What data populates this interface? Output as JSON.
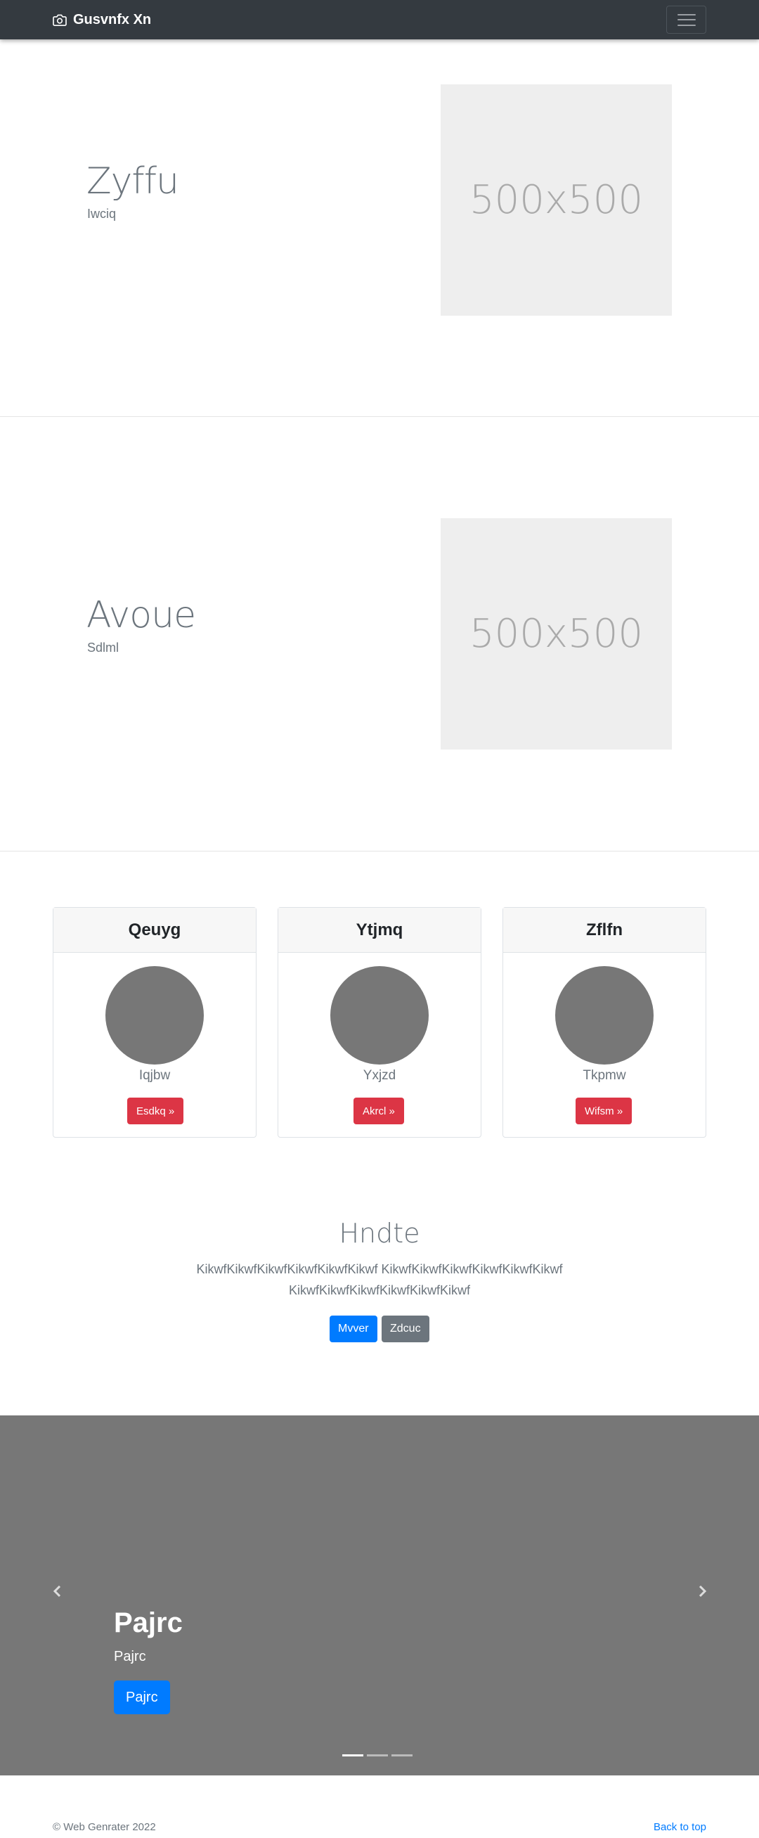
{
  "navbar": {
    "brand": "Gusvnfx Xn",
    "brand_icon": "camera-icon",
    "toggler_icon": "hamburger-menu-icon"
  },
  "features": [
    {
      "title": "Zyffu",
      "subtitle": "Iwciq",
      "image_label": "500x500"
    },
    {
      "title": "Avoue",
      "subtitle": "Sdlml",
      "image_label": "500x500"
    }
  ],
  "cards": [
    {
      "header": "Qeuyg",
      "name": "Iqjbw",
      "button": "Esdkq »"
    },
    {
      "header": "Ytjmq",
      "name": "Yxjzd",
      "button": "Akrcl »"
    },
    {
      "header": "Zflfn",
      "name": "Tkpmw",
      "button": "Wifsm »"
    }
  ],
  "cta": {
    "title": "Hndte",
    "lead": "KikwfKikwfKikwfKikwfKikwfKikwf KikwfKikwfKikwfKikwfKikwfKikwf KikwfKikwfKikwfKikwfKikwfKikwf",
    "primary_button": "Mvver",
    "secondary_button": "Zdcuc"
  },
  "carousel": {
    "title": "Pajrc",
    "subtitle": "Pajrc",
    "button": "Pajrc",
    "prev_icon": "chevron-left-icon",
    "next_icon": "chevron-right-icon",
    "indicator_count": 3,
    "active_index": 0
  },
  "footer": {
    "copyright": "© Web Genrater 2022",
    "back_to_top": "Back to top"
  },
  "colors": {
    "navbar_bg": "#343a40",
    "primary": "#007bff",
    "danger": "#dc3545",
    "secondary": "#6c757d",
    "carousel_bg": "#777777"
  }
}
